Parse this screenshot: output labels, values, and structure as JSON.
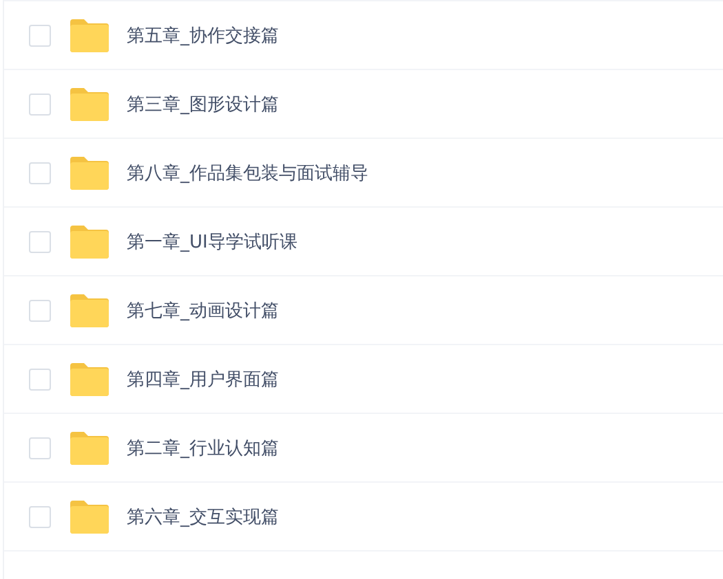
{
  "files": [
    {
      "name": "第五章_协作交接篇",
      "checked": false
    },
    {
      "name": "第三章_图形设计篇",
      "checked": false
    },
    {
      "name": "第八章_作品集包装与面试辅导",
      "checked": false
    },
    {
      "name": "第一章_UI导学试听课",
      "checked": false
    },
    {
      "name": "第七章_动画设计篇",
      "checked": false
    },
    {
      "name": "第四章_用户界面篇",
      "checked": false
    },
    {
      "name": "第二章_行业认知篇",
      "checked": false
    },
    {
      "name": "第六章_交互实现篇",
      "checked": false
    }
  ]
}
